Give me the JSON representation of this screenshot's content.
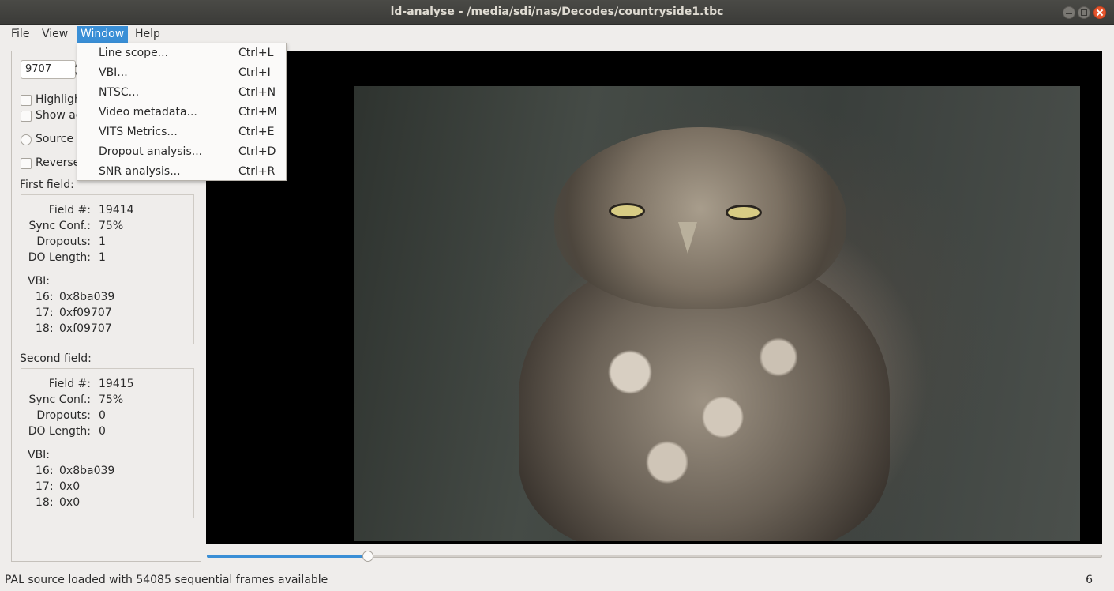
{
  "window": {
    "title": "ld-analyse - /media/sdi/nas/Decodes/countryside1.tbc"
  },
  "menubar": {
    "items": [
      {
        "label": "File"
      },
      {
        "label": "View"
      },
      {
        "label": "Window"
      },
      {
        "label": "Help"
      }
    ]
  },
  "window_menu": {
    "items": [
      {
        "label": "Line scope...",
        "shortcut": "Ctrl+L"
      },
      {
        "label": "VBI...",
        "shortcut": "Ctrl+I"
      },
      {
        "label": "NTSC...",
        "shortcut": "Ctrl+N"
      },
      {
        "label": "Video metadata...",
        "shortcut": "Ctrl+M"
      },
      {
        "label": "VITS Metrics...",
        "shortcut": "Ctrl+E"
      },
      {
        "label": "Dropout analysis...",
        "shortcut": "Ctrl+D"
      },
      {
        "label": "SNR analysis...",
        "shortcut": "Ctrl+R"
      }
    ]
  },
  "left_panel": {
    "frame_number": "9707",
    "options": {
      "highlight_label": "Highligh",
      "show_label": "Show ac",
      "source_label": "Source",
      "reverse_label": "Reverse"
    },
    "first_field": {
      "title": "First field:",
      "field_num_key": "Field #:",
      "field_num": "19414",
      "sync_conf_key": "Sync Conf.:",
      "sync_conf": "75%",
      "dropouts_key": "Dropouts:",
      "dropouts": "1",
      "do_length_key": "DO Length:",
      "do_length": "1",
      "vbi_title": "VBI:",
      "vbi": [
        {
          "line": "16:",
          "value": "0x8ba039"
        },
        {
          "line": "17:",
          "value": "0xf09707"
        },
        {
          "line": "18:",
          "value": "0xf09707"
        }
      ]
    },
    "second_field": {
      "title": "Second field:",
      "field_num_key": "Field #:",
      "field_num": "19415",
      "sync_conf_key": "Sync Conf.:",
      "sync_conf": "75%",
      "dropouts_key": "Dropouts:",
      "dropouts": "0",
      "do_length_key": "DO Length:",
      "do_length": "0",
      "vbi_title": "VBI:",
      "vbi": [
        {
          "line": "16:",
          "value": "0x8ba039"
        },
        {
          "line": "17:",
          "value": "0x0"
        },
        {
          "line": "18:",
          "value": "0x0"
        }
      ]
    }
  },
  "slider": {
    "position_fraction": 0.18
  },
  "status": {
    "message": "PAL source loaded with 54085 sequential frames available",
    "number": "6"
  },
  "colors": {
    "accent": "#3a8fd6",
    "close_button": "#e5552d",
    "titlebar": "#3b3b38"
  },
  "icons": [
    "minimize-icon",
    "maximize-icon",
    "close-icon",
    "spin-up-icon",
    "spin-down-icon"
  ]
}
